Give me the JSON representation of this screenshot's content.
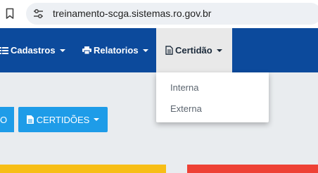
{
  "browser": {
    "url": "treinamento-scga.sistemas.ro.gov.br",
    "icons": {
      "bookmark": "bookmark-icon",
      "site_info": "site-info-icon"
    }
  },
  "navbar": {
    "items": [
      {
        "label": "Cadastros",
        "icon": "list-icon"
      },
      {
        "label": "Relatorios",
        "icon": "print-icon"
      },
      {
        "label": "Certidão",
        "icon": "file-icon",
        "active": true
      }
    ]
  },
  "dropdown": {
    "items": [
      "Interna",
      "Externa"
    ]
  },
  "buttons": {
    "left_partial": "O",
    "certidoes": "CERTIDÕES"
  },
  "colors": {
    "navbar": "#0c4a9c",
    "active_nav": "#e9e9e9",
    "button": "#1e9ce8",
    "panel_yellow": "#f7be16",
    "panel_red": "#ee4135",
    "page_bg": "#e9ecef"
  }
}
